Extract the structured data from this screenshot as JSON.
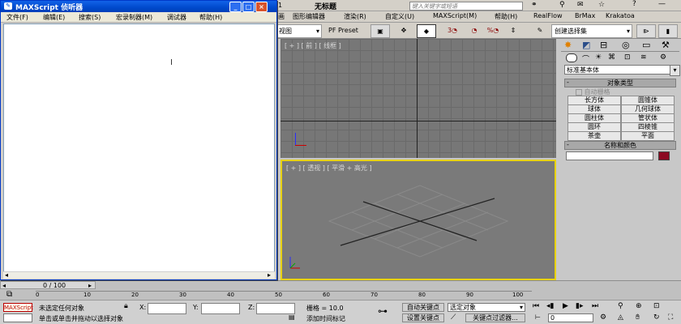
{
  "max": {
    "title": "无标题",
    "title_prefix": "1",
    "search_placeholder": "键入关键字或短语",
    "menu": [
      "图形编辑器",
      "渲染(R)",
      "自定义(U)",
      "MAXScript(M)",
      "帮助(H)",
      "RealFlow",
      "BrMax",
      "Krakatoa"
    ],
    "menu_leading": "画",
    "toolbar": {
      "view_dropdown": "视图",
      "pf_preset": "PF Preset",
      "selection_set": "创建选择集"
    },
    "viewports": {
      "top_label": "[ + ] [ 前 ] [ 线框 ]",
      "persp_label": "[ + ] [ 透视 ] [ 平滑 + 高光 ]"
    },
    "command_panel": {
      "category": "标准基本体",
      "object_type_header": "对象类型",
      "autogrid": "自动栅格",
      "buttons": [
        "长方体",
        "圆锥体",
        "球体",
        "几何球体",
        "圆柱体",
        "管状体",
        "圆环",
        "四棱锥",
        "茶壶",
        "平面"
      ],
      "name_color_header": "名称和颜色",
      "object_color": "#8b0a22"
    },
    "timeline": {
      "frame_counter": "0 / 100",
      "ticks": [
        "0",
        "10",
        "20",
        "30",
        "40",
        "50",
        "60",
        "70",
        "80",
        "90",
        "100"
      ]
    },
    "status": {
      "maxscript_tag": "MAXScript",
      "selection_status": "未选定任何对象",
      "hint": "单击或单击并拖动以选择对象",
      "x_label": "X:",
      "y_label": "Y:",
      "z_label": "Z:",
      "grid": "栅格 = 10.0",
      "auto_key": "自动关键点",
      "set_key": "设置关键点",
      "selected_dropdown": "选定对象",
      "key_filters": "关键点过滤器...",
      "add_time_tag": "添加时间标记",
      "frame_value": "0"
    }
  },
  "listener": {
    "title": "MAXScript 侦听器",
    "menu": [
      "文件(F)",
      "编辑(E)",
      "搜索(S)",
      "宏录制器(M)",
      "调试器",
      "帮助(H)"
    ],
    "buttons": {
      "minimize": "_",
      "maximize": "□",
      "close": "×"
    }
  }
}
